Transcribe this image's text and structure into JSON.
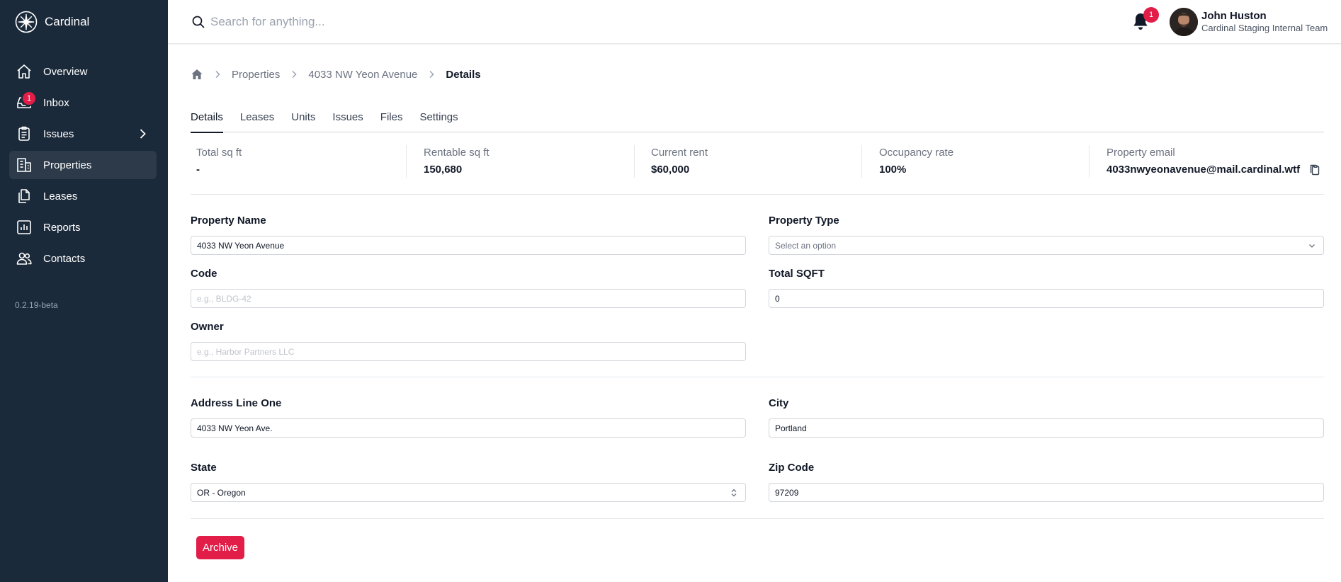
{
  "app": {
    "name": "Cardinal",
    "version": "0.2.19-beta"
  },
  "sidebar": {
    "items": [
      {
        "label": "Overview"
      },
      {
        "label": "Inbox",
        "badge": "1"
      },
      {
        "label": "Issues"
      },
      {
        "label": "Properties"
      },
      {
        "label": "Leases"
      },
      {
        "label": "Reports"
      },
      {
        "label": "Contacts"
      }
    ]
  },
  "topbar": {
    "search_placeholder": "Search for anything...",
    "notifications_count": "1",
    "user": {
      "name": "John Huston",
      "team": "Cardinal Staging Internal Team"
    }
  },
  "breadcrumb": {
    "items": [
      "Properties",
      "4033 NW Yeon Avenue"
    ],
    "current": "Details"
  },
  "tabs": {
    "items": [
      "Details",
      "Leases",
      "Units",
      "Issues",
      "Files",
      "Settings"
    ],
    "active": "Details"
  },
  "stats": [
    {
      "label": "Total sq ft",
      "value": "-"
    },
    {
      "label": "Rentable sq ft",
      "value": "150,680"
    },
    {
      "label": "Current rent",
      "value": "$60,000"
    },
    {
      "label": "Occupancy rate",
      "value": "100%"
    },
    {
      "label": "Property email",
      "value": "4033nwyeonavenue@mail.cardinal.wtf"
    }
  ],
  "form": {
    "property_name": {
      "label": "Property Name",
      "value": "4033 NW Yeon Avenue"
    },
    "property_type": {
      "label": "Property Type",
      "placeholder": "Select an option"
    },
    "code": {
      "label": "Code",
      "placeholder": "e.g., BLDG-42",
      "value": ""
    },
    "total_sqft": {
      "label": "Total SQFT",
      "value": "0"
    },
    "owner": {
      "label": "Owner",
      "placeholder": "e.g., Harbor Partners LLC",
      "value": ""
    },
    "address_line_one": {
      "label": "Address Line One",
      "value": "4033 NW Yeon Ave."
    },
    "city": {
      "label": "City",
      "value": "Portland"
    },
    "state": {
      "label": "State",
      "value": "OR - Oregon"
    },
    "zip_code": {
      "label": "Zip Code",
      "value": "97209"
    }
  },
  "actions": {
    "archive_label": "Archive"
  },
  "colors": {
    "sidebar_bg": "#1b2a3a",
    "accent": "#e11d48",
    "sidebar_active": "#2c3a4a"
  },
  "icons": {
    "sidebar": [
      "home-icon",
      "inbox-icon",
      "clipboard-icon",
      "building-icon",
      "documents-icon",
      "chart-icon",
      "users-icon"
    ],
    "topbar": [
      "search-icon",
      "bell-icon"
    ]
  }
}
